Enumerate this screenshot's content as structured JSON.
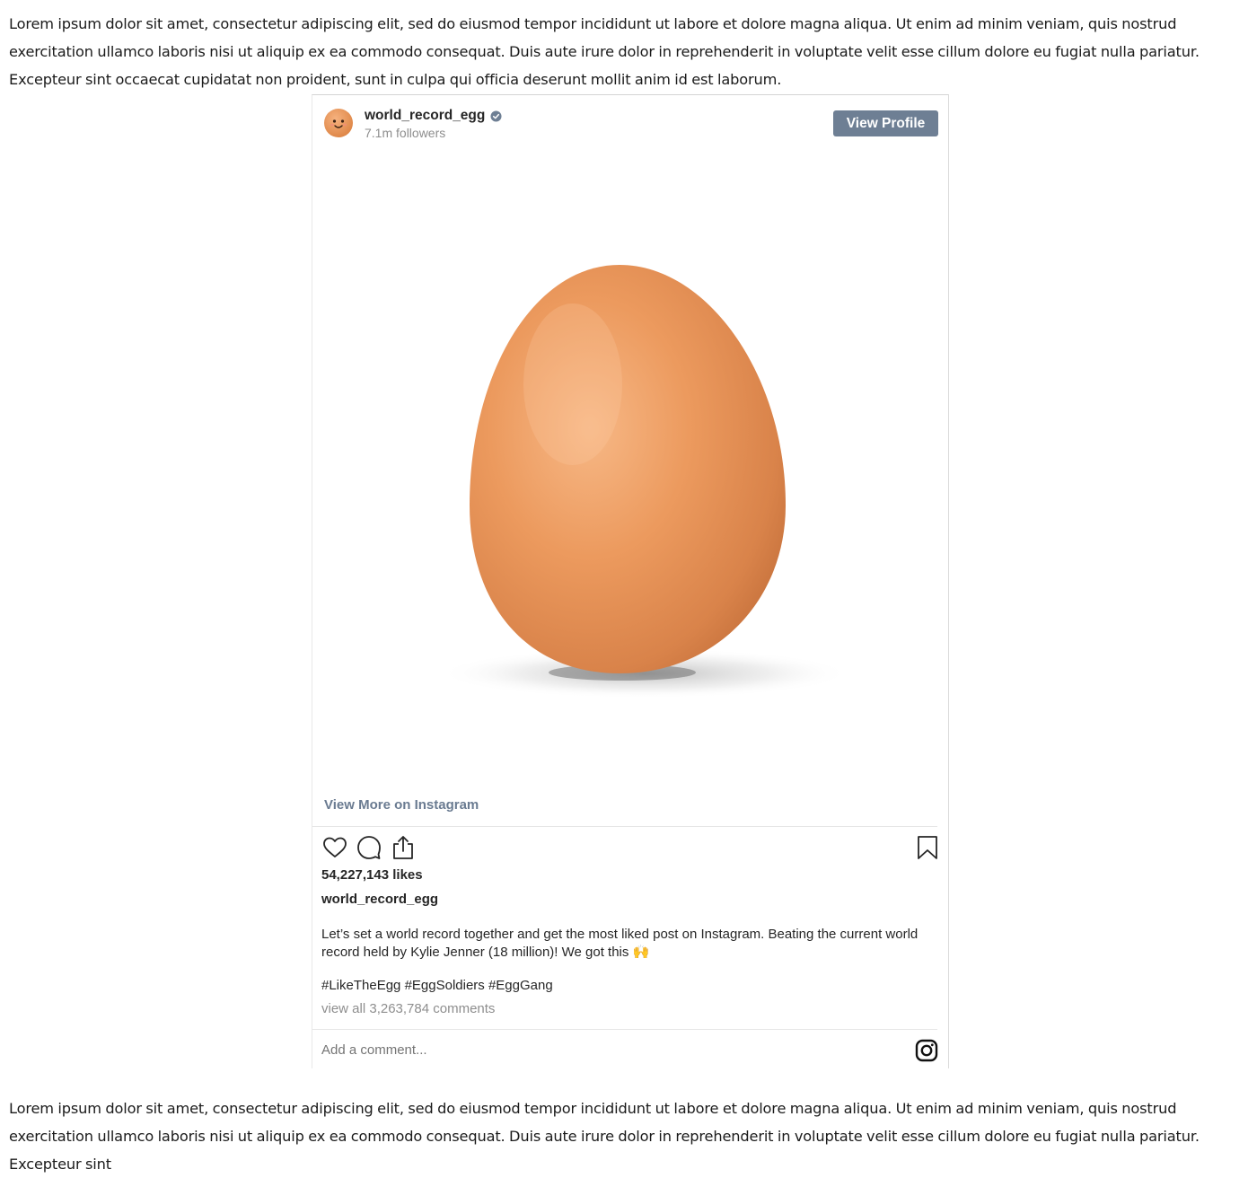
{
  "article": {
    "paragraph_top": "Lorem ipsum dolor sit amet, consectetur adipiscing elit, sed do eiusmod tempor incididunt ut labore et dolore magna aliqua. Ut enim ad minim veniam, quis nostrud exercitation ullamco laboris nisi ut aliquip ex ea commodo consequat. Duis aute irure dolor in reprehenderit in voluptate velit esse cillum dolore eu fugiat nulla pariatur. Excepteur sint occaecat cupidatat non proident, sunt in culpa qui officia deserunt mollit anim id est laborum.",
    "paragraph_bottom": "Lorem ipsum dolor sit amet, consectetur adipiscing elit, sed do eiusmod tempor incididunt ut labore et dolore magna aliqua. Ut enim ad minim veniam, quis nostrud exercitation ullamco laboris nisi ut aliquip ex ea commodo consequat. Duis aute irure dolor in reprehenderit in voluptate velit esse cillum dolore eu fugiat nulla pariatur. Excepteur sint"
  },
  "embed": {
    "username": "world_record_egg",
    "followers": "7.1m followers",
    "view_profile_label": "View Profile",
    "view_more_label": "View More on Instagram",
    "likes": "54,227,143 likes",
    "caption_user": "world_record_egg",
    "caption_text": "Let’s set a world record together and get the most liked post on Instagram. Beating the current world record held by Kylie Jenner (18 million)! We got this 🙌",
    "hashtags": "#LikeTheEgg #EggSoldiers #EggGang",
    "comments_link": "view all 3,263,784 comments",
    "comment_placeholder": "Add a comment...",
    "icons": [
      "verified-badge-icon",
      "heart-icon",
      "comment-icon",
      "share-icon",
      "bookmark-icon",
      "instagram-logo-icon"
    ],
    "colors": {
      "button_bg": "#6e7f94",
      "link": "#6a7b91",
      "egg": "#e8955a",
      "muted_text": "#8e8e8e"
    }
  }
}
